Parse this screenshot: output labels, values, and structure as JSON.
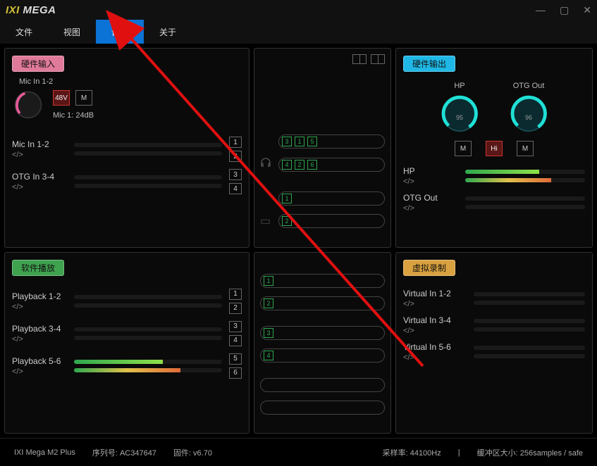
{
  "app": {
    "logo_left": "IXI",
    "logo_right": " MEGA"
  },
  "window": {
    "minimize": "—",
    "maximize": "▢",
    "close": "✕"
  },
  "menu": {
    "items": [
      "文件",
      "视图",
      "设置",
      "关于"
    ],
    "active_index": 2
  },
  "hw_input": {
    "tag": "硬件输入",
    "mic_title": "Mic In 1-2",
    "phantom": "48V",
    "mute": "M",
    "gain_label": "Mic 1: 24dB",
    "channels": [
      {
        "name": "Mic In 1-2",
        "close": "</>",
        "num1": "1",
        "num2": "2",
        "fill": 0
      },
      {
        "name": "OTG In 3-4",
        "close": "</>",
        "num1": "3",
        "num2": "4",
        "fill": 0
      }
    ]
  },
  "sw_playback": {
    "tag": "软件播放",
    "channels": [
      {
        "name": "Playback 1-2",
        "close": "</>",
        "num1": "1",
        "num2": "2",
        "fill": 0
      },
      {
        "name": "Playback 3-4",
        "close": "</>",
        "num1": "3",
        "num2": "4",
        "fill": 0
      },
      {
        "name": "Playback 5-6",
        "close": "</>",
        "num1": "5",
        "num2": "6",
        "fill": 60,
        "fill2": 72
      }
    ]
  },
  "center_top": {
    "rows": [
      {
        "icon": "",
        "nums": [
          "3",
          "1",
          "5"
        ]
      },
      {
        "icon": "headphones",
        "nums": [
          "4",
          "2",
          "6"
        ]
      },
      {
        "icon": "",
        "nums": [
          "1"
        ]
      },
      {
        "icon": "box",
        "nums": [
          "2"
        ]
      }
    ]
  },
  "center_bottom": {
    "rows": [
      {
        "nums": [
          "1"
        ]
      },
      {
        "nums": [
          "2"
        ]
      },
      {
        "nums": [
          "3"
        ]
      },
      {
        "nums": [
          "4"
        ]
      },
      {
        "nums": []
      },
      {
        "nums": []
      }
    ]
  },
  "hw_output": {
    "tag": "硬件输出",
    "knobs": [
      {
        "name": "HP",
        "val": "95"
      },
      {
        "name": "OTG Out",
        "val": "96"
      }
    ],
    "btns": {
      "m1": "M",
      "hi": "Hi",
      "m2": "M"
    },
    "channels": [
      {
        "name": "HP",
        "close": "</>",
        "fill": 62,
        "fill2": 72
      },
      {
        "name": "OTG Out",
        "close": "</>",
        "fill": 0
      }
    ]
  },
  "virtual_rec": {
    "tag": "虚拟录制",
    "channels": [
      {
        "name": "Virtual In 1-2",
        "close": "</>"
      },
      {
        "name": "Virtual In 3-4",
        "close": "</>"
      },
      {
        "name": "Virtual In 5-6",
        "close": "</>"
      }
    ]
  },
  "footer": {
    "device": "IXI Mega M2 Plus",
    "serial_label": "序列号: AC347647",
    "fw_label": "固件: v6.70",
    "sr_label": "采样率: 44100Hz",
    "buf_label": "缓冲区大小: 256samples / safe",
    "sep": "|"
  }
}
